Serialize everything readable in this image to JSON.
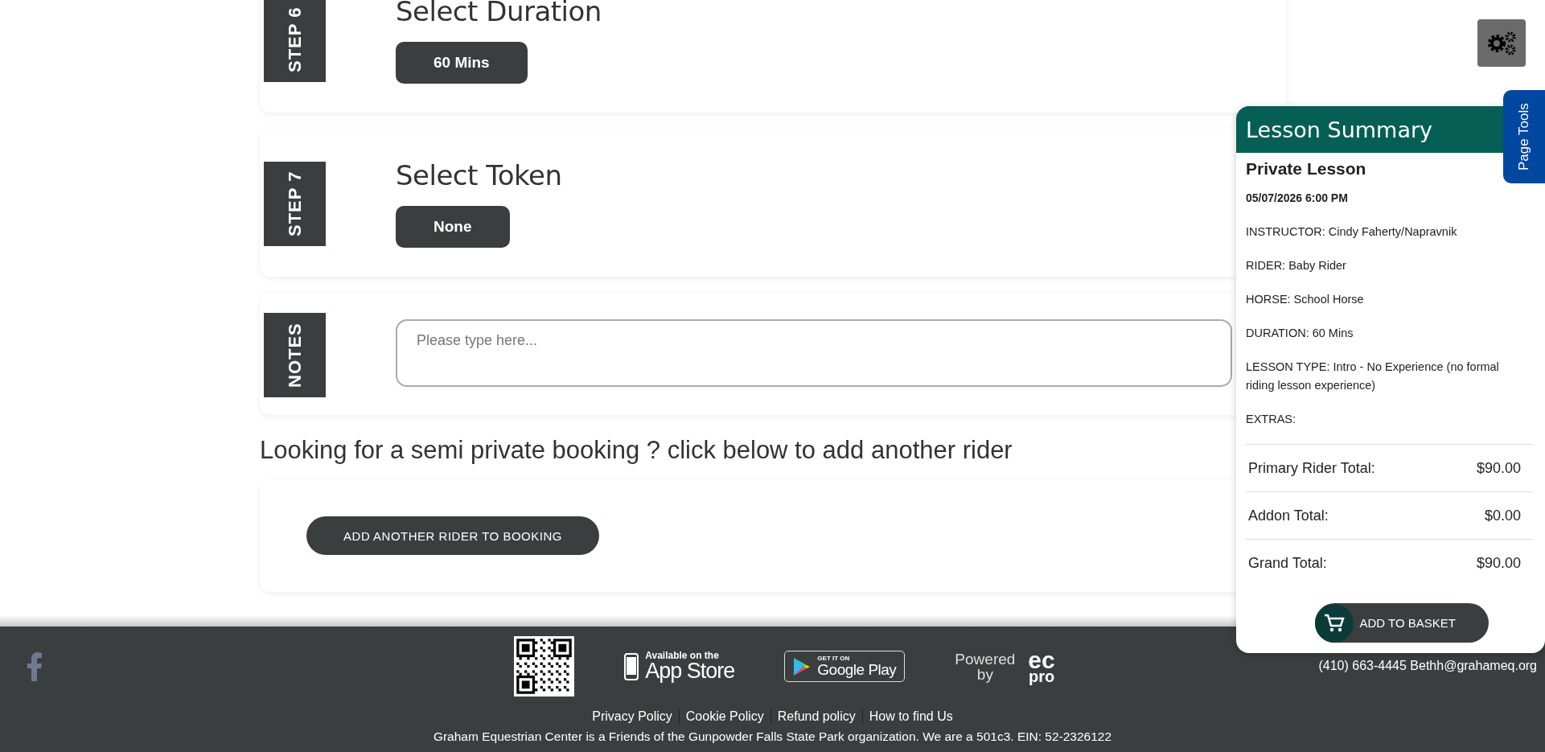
{
  "steps": [
    {
      "kind": "options",
      "label": "STEP 6",
      "title": "Select Duration",
      "options": [
        {
          "label": "60 Mins",
          "selected": true
        }
      ]
    },
    {
      "kind": "options",
      "label": "STEP 7",
      "title": "Select Token",
      "options": [
        {
          "label": "None",
          "selected": true
        }
      ]
    },
    {
      "kind": "notes",
      "label": "NOTES",
      "placeholder": "Please type here..."
    }
  ],
  "semi_private": {
    "text": "Looking for a semi private booking ? click below to add another rider",
    "button": "ADD ANOTHER RIDER TO BOOKING"
  },
  "summary": {
    "title": "Lesson Summary",
    "lesson": "Private Lesson",
    "datetime": "05/07/2026 6:00 PM",
    "details": [
      "INSTRUCTOR: Cindy Faherty/Napravnik",
      "RIDER: Baby Rider",
      "HORSE: School Horse",
      "DURATION: 60 Mins",
      "LESSON TYPE: Intro - No Experience (no formal riding lesson experience)",
      "EXTRAS:"
    ],
    "totals": [
      {
        "label": "Primary Rider Total:",
        "amount": "$90.00"
      },
      {
        "label": "Addon Total:",
        "amount": "$0.00"
      },
      {
        "label": "Grand Total:",
        "amount": "$90.00"
      }
    ],
    "button": "ADD TO BASKET"
  },
  "page_tools": "Page Tools",
  "footer": {
    "app_store": {
      "small": "Available on the",
      "big": "App Store"
    },
    "google_play": {
      "small": "GET IT ON",
      "big": "Google Play"
    },
    "powered": {
      "line1": "Powered",
      "line2": "by",
      "logo_top": "ec",
      "logo_bottom": "pro"
    },
    "contact": "(410) 663-4445 Bethh@grahameq.org",
    "links": [
      "Privacy Policy",
      "Cookie Policy",
      "Refund policy",
      "How to find Us"
    ],
    "org_note": "Graham Equestrian Center is a Friends of the Gunpowder Falls State Park organization. We are a 501c3. EIN: 52-2326122"
  }
}
